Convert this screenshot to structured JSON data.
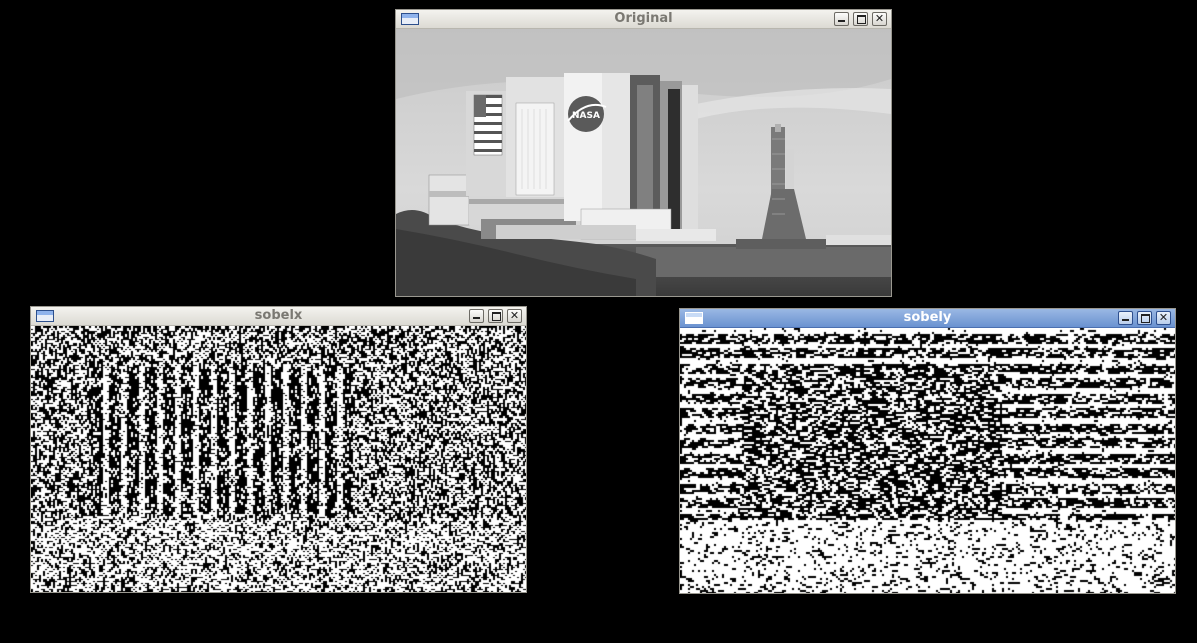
{
  "windows": {
    "original": {
      "title": "Original",
      "active": false,
      "content": "grayscale photograph of NASA Vehicle Assembly Building and launch tower",
      "logo_text": "NASA"
    },
    "sobelx": {
      "title": "sobelx",
      "active": false,
      "content": "binary horizontal-gradient edge map"
    },
    "sobely": {
      "title": "sobely",
      "active": true,
      "content": "binary vertical-gradient edge map"
    }
  },
  "controls": {
    "minimize_icon": "minimize-icon",
    "maximize_icon": "maximize-icon",
    "close_icon": "close-icon",
    "close_glyph": "✕"
  },
  "colors": {
    "desktop": "#000000",
    "inactive_title_text": "#7a7872",
    "active_title_bar": "#7fa3da",
    "active_title_text": "#ffffff"
  }
}
